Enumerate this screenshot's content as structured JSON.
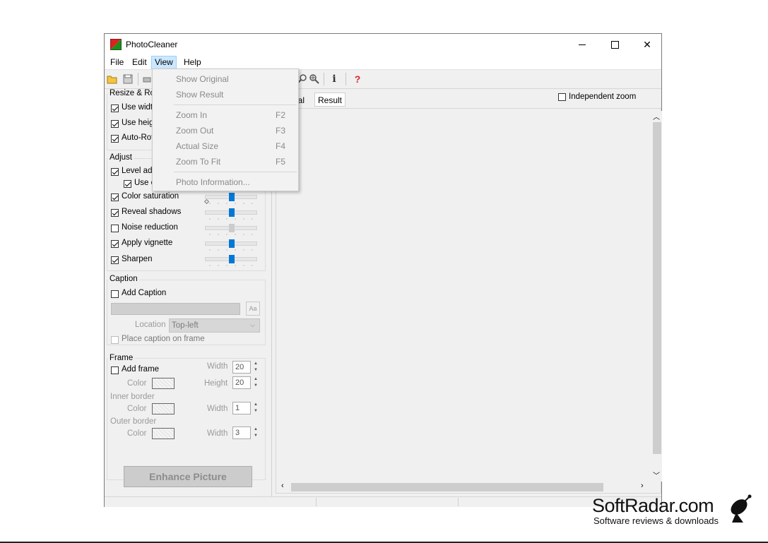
{
  "window": {
    "title": "PhotoCleaner",
    "controls": {
      "minimize": "—",
      "maximize": "☐",
      "close": "✕"
    }
  },
  "menubar": {
    "items": [
      "File",
      "Edit",
      "View",
      "Help"
    ],
    "active": "View"
  },
  "toolbar": {
    "icons": [
      "open-folder-icon",
      "save-icon",
      "print-icon",
      "zoom-out-icon",
      "zoom-fit-icon",
      "info-icon",
      "help-icon"
    ]
  },
  "view_menu": {
    "items": [
      {
        "label": "Show Original",
        "shortcut": ""
      },
      {
        "label": "Show Result",
        "shortcut": ""
      },
      {
        "label": "Zoom In",
        "shortcut": "F2"
      },
      {
        "label": "Zoom Out",
        "shortcut": "F3"
      },
      {
        "label": "Actual Size",
        "shortcut": "F4"
      },
      {
        "label": "Zoom To Fit",
        "shortcut": "F5"
      },
      {
        "label": "Photo Information...",
        "shortcut": ""
      }
    ]
  },
  "resize": {
    "title": "Resize & Rot",
    "use_width": "Use width",
    "use_height": "Use heigh",
    "auto_rotate": "Auto-Rot"
  },
  "adjust": {
    "title": "Adjust",
    "level_adjust": "Level adj",
    "use_sub": "Use c",
    "color_saturation": "Color saturation",
    "reveal_shadows": "Reveal shadows",
    "noise_reduction": "Noise reduction",
    "apply_vignette": "Apply vignette",
    "sharpen": "Sharpen"
  },
  "caption": {
    "title": "Caption",
    "add_caption": "Add Caption",
    "location_label": "Location",
    "location_value": "Top-left",
    "place_on_frame": "Place caption on frame",
    "font_button": "Aa"
  },
  "frame": {
    "title": "Frame",
    "add_frame": "Add frame",
    "width_label": "Width",
    "height_label": "Height",
    "color_label": "Color",
    "width_value": "20",
    "height_value": "20",
    "inner_border": "Inner border",
    "inner_width": "1",
    "outer_border": "Outer border",
    "outer_width": "3"
  },
  "enhance_button": "Enhance Picture",
  "tabs": {
    "original": "nal",
    "result": "Result"
  },
  "independent_zoom": "Independent zoom",
  "watermark": {
    "brand": "SoftRadar.com",
    "tagline": "Software reviews & downloads"
  }
}
